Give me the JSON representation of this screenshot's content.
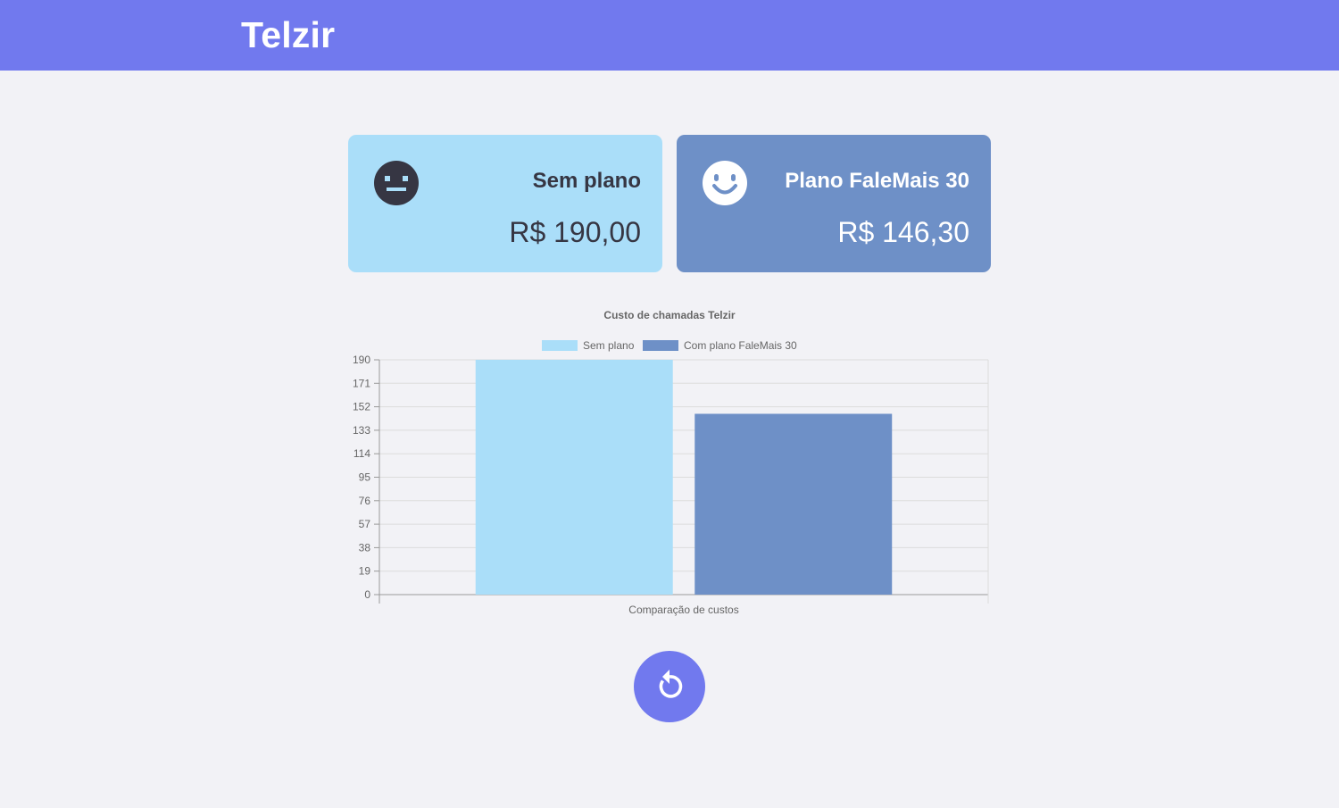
{
  "header": {
    "brand": "Telzir"
  },
  "cards": [
    {
      "title": "Sem plano",
      "price": "R$ 190,00",
      "icon": "neutral-face-icon"
    },
    {
      "title": "Plano FaleMais 30",
      "price": "R$ 146,30",
      "icon": "smiling-face-icon"
    }
  ],
  "colors": {
    "header": "#7179ee",
    "sem_plano": "#aadef9",
    "fale_mais": "#6e90c7",
    "background": "#f2f2f6"
  },
  "chart_data": {
    "type": "bar",
    "title": "Custo de chamadas Telzir",
    "xlabel": "Comparação de custos",
    "ylabel": "",
    "categories": [
      ""
    ],
    "series": [
      {
        "name": "Sem plano",
        "values": [
          190
        ],
        "color": "#aadef9"
      },
      {
        "name": "Com plano FaleMais 30",
        "values": [
          146.3
        ],
        "color": "#6e90c7"
      }
    ],
    "ylim": [
      0,
      190
    ],
    "yticks": [
      "0",
      "19",
      "38",
      "57",
      "76",
      "95",
      "114",
      "133",
      "152",
      "171",
      "190"
    ],
    "grid": true,
    "legend": "top"
  },
  "reset_button": {
    "icon": "reset-icon"
  }
}
